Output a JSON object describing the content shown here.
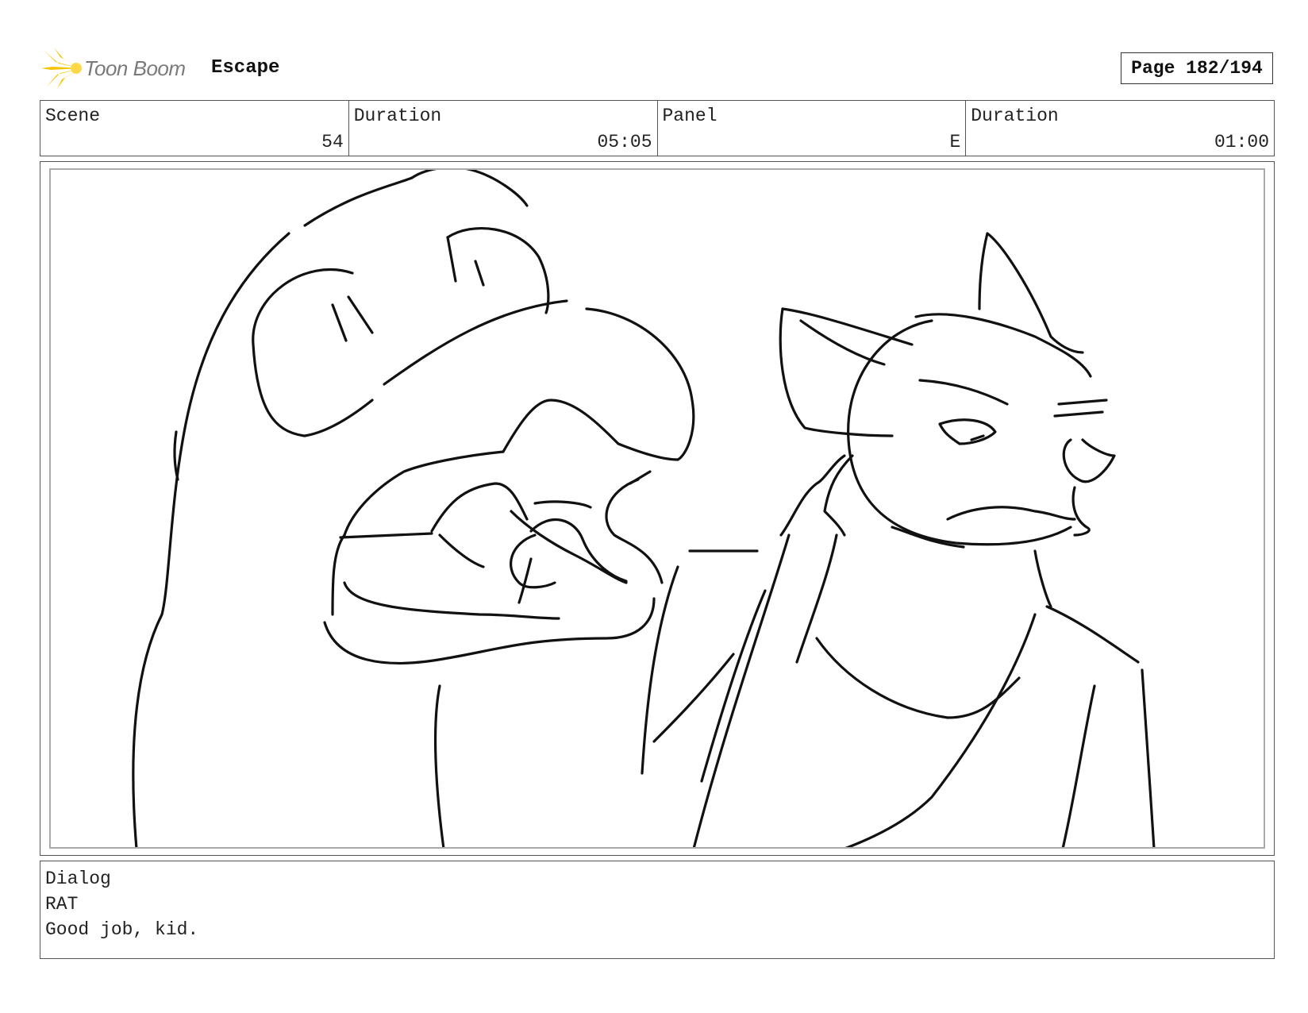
{
  "header": {
    "brand_name": "Toon Boom",
    "project_title": "Escape",
    "page_label": "Page 182/194"
  },
  "info": {
    "scene_label": "Scene",
    "scene_value": "54",
    "scene_duration_label": "Duration",
    "scene_duration_value": "05:05",
    "panel_label": "Panel",
    "panel_value": "E",
    "panel_duration_label": "Duration",
    "panel_duration_value": "01:00"
  },
  "dialog": {
    "label": "Dialog",
    "character": "RAT",
    "line": "Good job, kid."
  },
  "colors": {
    "logo_accent": "#f5c400",
    "border": "#555555",
    "inner_border": "#aaaaaa"
  },
  "icons": {
    "logo": "toon-boom-starburst-icon"
  }
}
